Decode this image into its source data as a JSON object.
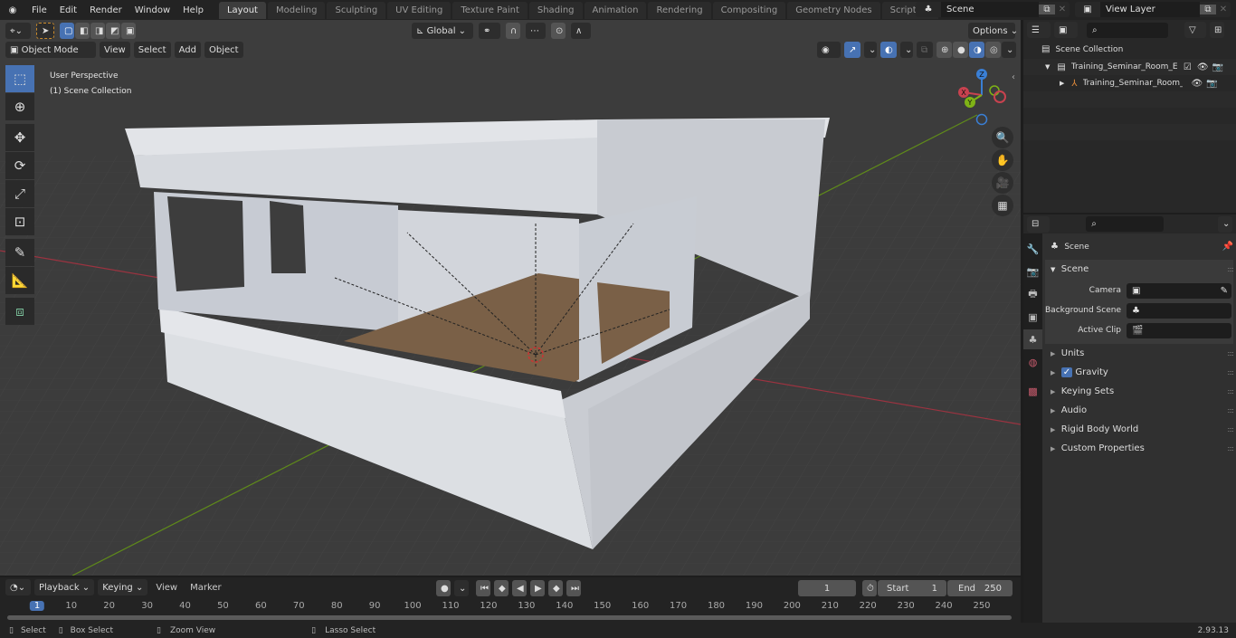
{
  "app": {
    "logo": "blender-logo",
    "version": "2.93.13"
  },
  "menu": [
    "File",
    "Edit",
    "Render",
    "Window",
    "Help"
  ],
  "workspaces": [
    {
      "label": "Layout",
      "active": true
    },
    {
      "label": "Modeling"
    },
    {
      "label": "Sculpting"
    },
    {
      "label": "UV Editing"
    },
    {
      "label": "Texture Paint"
    },
    {
      "label": "Shading"
    },
    {
      "label": "Animation"
    },
    {
      "label": "Rendering"
    },
    {
      "label": "Compositing"
    },
    {
      "label": "Geometry Nodes"
    },
    {
      "label": "Scripting"
    }
  ],
  "workspace_add": "+",
  "scene_selector": {
    "value": "Scene"
  },
  "view_layer_selector": {
    "value": "View Layer"
  },
  "viewport": {
    "mode": "Object Mode",
    "menus": [
      "View",
      "Select",
      "Add",
      "Object"
    ],
    "transform_orientation": "Global",
    "options_label": "Options",
    "overlay_text": [
      "User Perspective",
      "(1) Scene Collection"
    ],
    "gizmo_axes": [
      "X",
      "Y",
      "Z"
    ],
    "shading_mode": "solid",
    "colors": {
      "x_axis": "#c8424f",
      "y_axis": "#7fb316",
      "z_axis": "#3a7fd5",
      "floor": "#7a6047",
      "building": "#d8dbe0"
    }
  },
  "tools": [
    "select-box",
    "cursor",
    "move",
    "rotate",
    "scale",
    "transform",
    "annotate",
    "measure",
    "add-cube"
  ],
  "outliner": {
    "root": "Scene Collection",
    "items": [
      {
        "label": "Training_Seminar_Room_Emp",
        "type": "collection",
        "checked": true
      },
      {
        "label": "Training_Seminar_Room_",
        "type": "empty"
      }
    ]
  },
  "properties": {
    "context": "Scene",
    "panel": "Scene",
    "fields": [
      {
        "label": "Camera",
        "value": ""
      },
      {
        "label": "Background Scene",
        "value": ""
      },
      {
        "label": "Active Clip",
        "value": ""
      }
    ],
    "subpanels": [
      {
        "label": "Units"
      },
      {
        "label": "Gravity",
        "checkbox": true
      },
      {
        "label": "Keying Sets"
      },
      {
        "label": "Audio"
      },
      {
        "label": "Rigid Body World"
      },
      {
        "label": "Custom Properties"
      }
    ]
  },
  "timeline": {
    "menus": [
      "Playback",
      "Keying",
      "View",
      "Marker"
    ],
    "current_frame": "1",
    "start_label": "Start",
    "start": "1",
    "end_label": "End",
    "end": "250",
    "ruler": [
      "1",
      "10",
      "20",
      "30",
      "40",
      "50",
      "60",
      "70",
      "80",
      "90",
      "100",
      "110",
      "120",
      "130",
      "140",
      "150",
      "160",
      "170",
      "180",
      "190",
      "200",
      "210",
      "220",
      "230",
      "240",
      "250"
    ]
  },
  "statusbar": {
    "hints": [
      "Select",
      "Box Select",
      "Zoom View",
      "Lasso Select"
    ]
  }
}
